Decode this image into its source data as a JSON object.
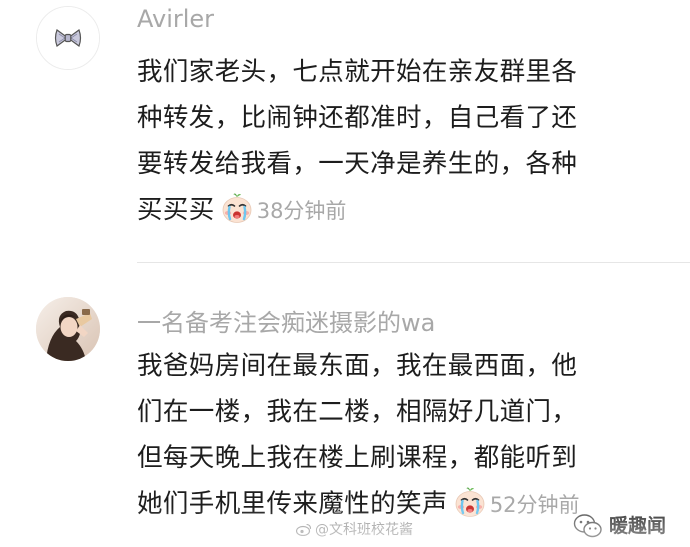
{
  "comments": [
    {
      "username": "Avirler",
      "avatar": "bow-avatar",
      "lines": [
        "我们家老头，七点就开始在亲友群里各",
        "种转发，比闹钟还都准时，自己看了还",
        "要转发给我看，一天净是养生的，各种",
        "买买买"
      ],
      "emoji": "crying-face-emoji",
      "time": "38分钟前"
    },
    {
      "username": "一名备考注会痴迷摄影的wa",
      "avatar": "photo-avatar",
      "lines": [
        "我爸妈房间在最东面，我在最西面，他",
        "们在一楼，我在二楼，相隔好几道门，",
        "但每天晚上我在楼上刷课程，都能听到",
        "她们手机里传来魔性的笑声"
      ],
      "emoji": "crying-face-emoji",
      "time": "52分钟前"
    }
  ],
  "watermark": {
    "text": "@文科班校花酱",
    "icon": "weibo-icon"
  },
  "brand": {
    "name": "暖趣闻",
    "icon": "wechat-icon"
  },
  "colors": {
    "username": "#a8a8a8",
    "body_text": "#1d1d1d",
    "timestamp": "#a8a8a8",
    "divider": "#e6e6e6"
  }
}
